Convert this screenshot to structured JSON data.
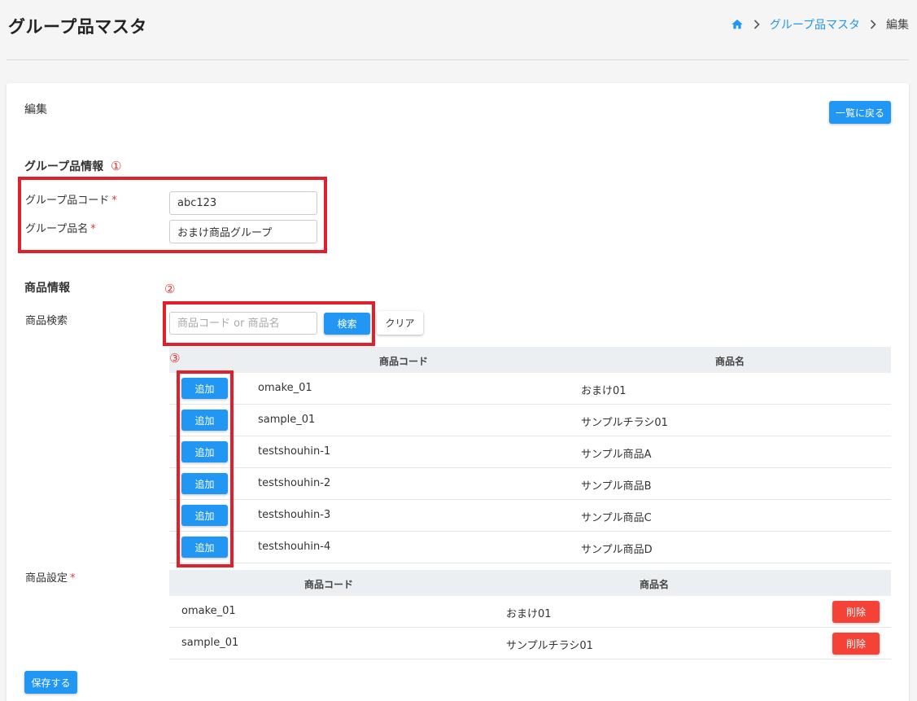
{
  "header": {
    "title": "グループ品マスタ",
    "breadcrumb": {
      "link": "グループ品マスタ",
      "current": "編集"
    }
  },
  "card": {
    "title": "編集",
    "back_label": "一覧に戻る"
  },
  "group_info": {
    "heading": "グループ品情報",
    "marker": "①",
    "code_label": "グループ品コード",
    "code_value": "abc123",
    "name_label": "グループ品名",
    "name_value": "おまけ商品グループ",
    "required_mark": "*"
  },
  "product_info": {
    "heading": "商品情報",
    "marker": "②",
    "search_label": "商品検索",
    "search_placeholder": "商品コード or 商品名",
    "search_button": "検索",
    "clear_button": "クリア"
  },
  "search_results": {
    "marker": "③",
    "columns": [
      "商品コード",
      "商品名"
    ],
    "add_label": "追加",
    "rows": [
      {
        "code": "omake_01",
        "name": "おまけ01"
      },
      {
        "code": "sample_01",
        "name": "サンプルチラシ01"
      },
      {
        "code": "testshouhin-1",
        "name": "サンプル商品A"
      },
      {
        "code": "testshouhin-2",
        "name": "サンプル商品B"
      },
      {
        "code": "testshouhin-3",
        "name": "サンプル商品C"
      },
      {
        "code": "testshouhin-4",
        "name": "サンプル商品D"
      }
    ]
  },
  "settings": {
    "label": "商品設定",
    "required_mark": "*",
    "columns": [
      "商品コード",
      "商品名"
    ],
    "delete_label": "削除",
    "rows": [
      {
        "code": "omake_01",
        "name": "おまけ01"
      },
      {
        "code": "sample_01",
        "name": "サンプルチラシ01"
      }
    ]
  },
  "save_label": "保存する",
  "colors": {
    "primary": "#2196f3",
    "danger": "#f44336",
    "highlight": "#e0202a"
  }
}
